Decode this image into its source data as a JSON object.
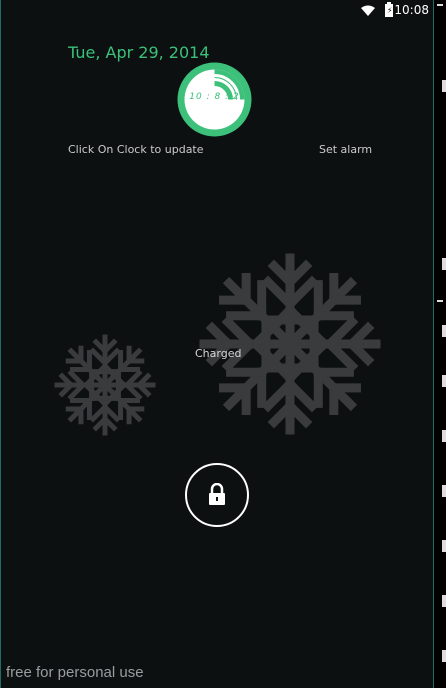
{
  "status_bar": {
    "time": "10:08",
    "icons": [
      "wifi-icon",
      "battery-charging-icon"
    ]
  },
  "lockscreen": {
    "date": "Tue, Apr 29, 2014",
    "clock_time": "10 : 8 : 2",
    "clock_hint": "Click On Clock to update",
    "set_alarm_label": "Set alarm",
    "battery_status": "Charged",
    "unlock_icon": "padlock-icon"
  },
  "watermark": "free for personal use",
  "colors": {
    "accent": "#3cc07a",
    "background": "#0d1011",
    "snowflake": "#3a3b3c"
  }
}
